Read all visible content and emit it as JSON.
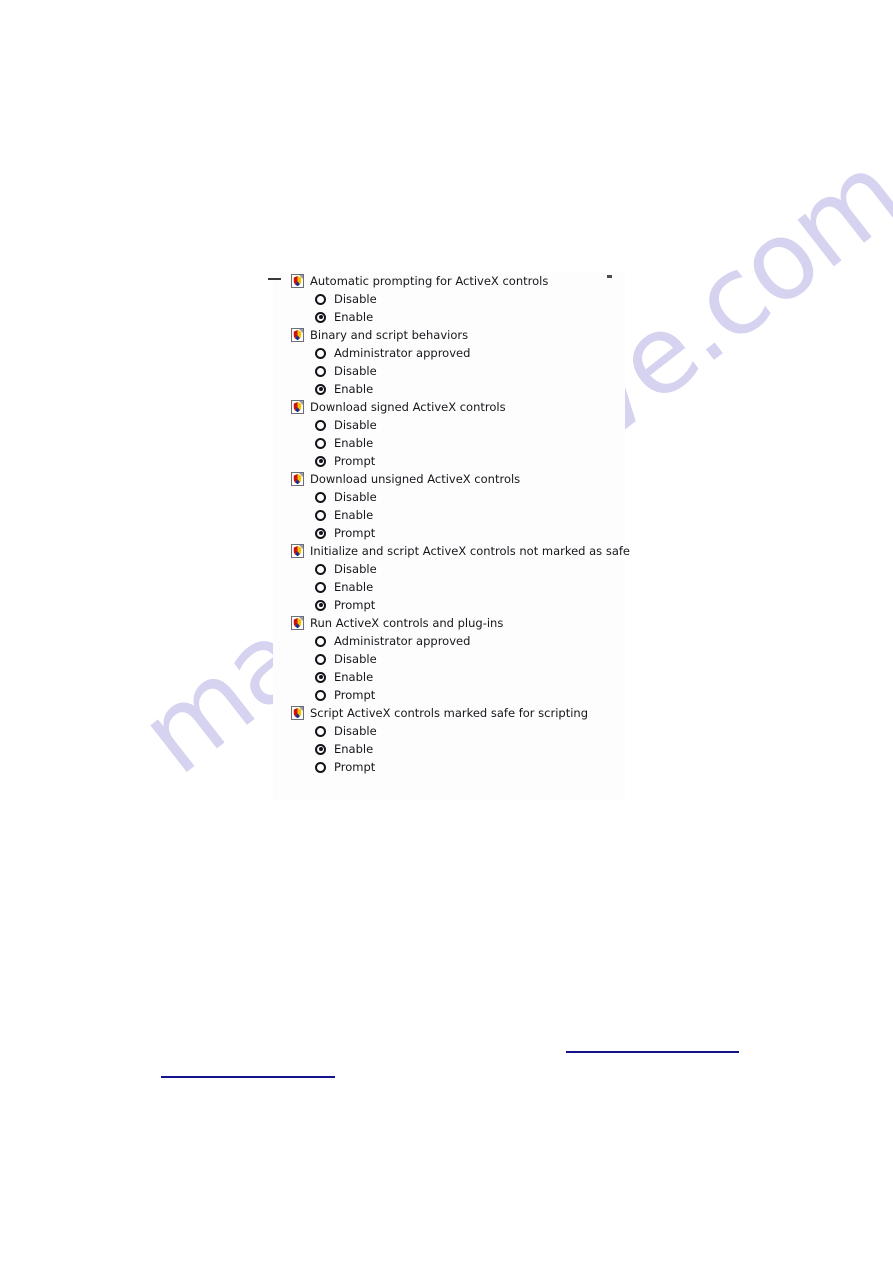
{
  "page": {
    "watermark_text": "manualshive.com",
    "watermark_color": "#d5d3f0",
    "background_color": "#ffffff"
  },
  "settings_panel": {
    "name": "activex-controls-and-plug-ins-settings",
    "background_color": "#fdfdfe",
    "collapse_indicator": "—",
    "groups": [
      {
        "icon": "policy-page-icon",
        "label": "Automatic prompting for ActiveX controls",
        "options": [
          {
            "label": "Disable",
            "selected": false
          },
          {
            "label": "Enable",
            "selected": true
          }
        ]
      },
      {
        "icon": "policy-page-icon",
        "label": "Binary and script behaviors",
        "options": [
          {
            "label": "Administrator approved",
            "selected": false
          },
          {
            "label": "Disable",
            "selected": false
          },
          {
            "label": "Enable",
            "selected": true
          }
        ]
      },
      {
        "icon": "policy-page-icon",
        "label": "Download signed ActiveX controls",
        "options": [
          {
            "label": "Disable",
            "selected": false
          },
          {
            "label": "Enable",
            "selected": false
          },
          {
            "label": "Prompt",
            "selected": true
          }
        ]
      },
      {
        "icon": "policy-page-icon",
        "label": "Download unsigned ActiveX controls",
        "options": [
          {
            "label": "Disable",
            "selected": false
          },
          {
            "label": "Enable",
            "selected": false
          },
          {
            "label": "Prompt",
            "selected": true
          }
        ]
      },
      {
        "icon": "policy-page-icon",
        "label": "Initialize and script ActiveX controls not marked as safe",
        "options": [
          {
            "label": "Disable",
            "selected": false
          },
          {
            "label": "Enable",
            "selected": false
          },
          {
            "label": "Prompt",
            "selected": true
          }
        ]
      },
      {
        "icon": "policy-page-icon",
        "label": "Run ActiveX controls and plug-ins",
        "options": [
          {
            "label": "Administrator approved",
            "selected": false
          },
          {
            "label": "Disable",
            "selected": false
          },
          {
            "label": "Enable",
            "selected": true
          },
          {
            "label": "Prompt",
            "selected": false
          }
        ]
      },
      {
        "icon": "policy-page-icon",
        "label": "Script ActiveX controls marked safe for scripting",
        "options": [
          {
            "label": "Disable",
            "selected": false
          },
          {
            "label": "Enable",
            "selected": true
          },
          {
            "label": "Prompt",
            "selected": false
          }
        ]
      }
    ]
  },
  "rules": {
    "color": "#13138c",
    "count": 2
  }
}
